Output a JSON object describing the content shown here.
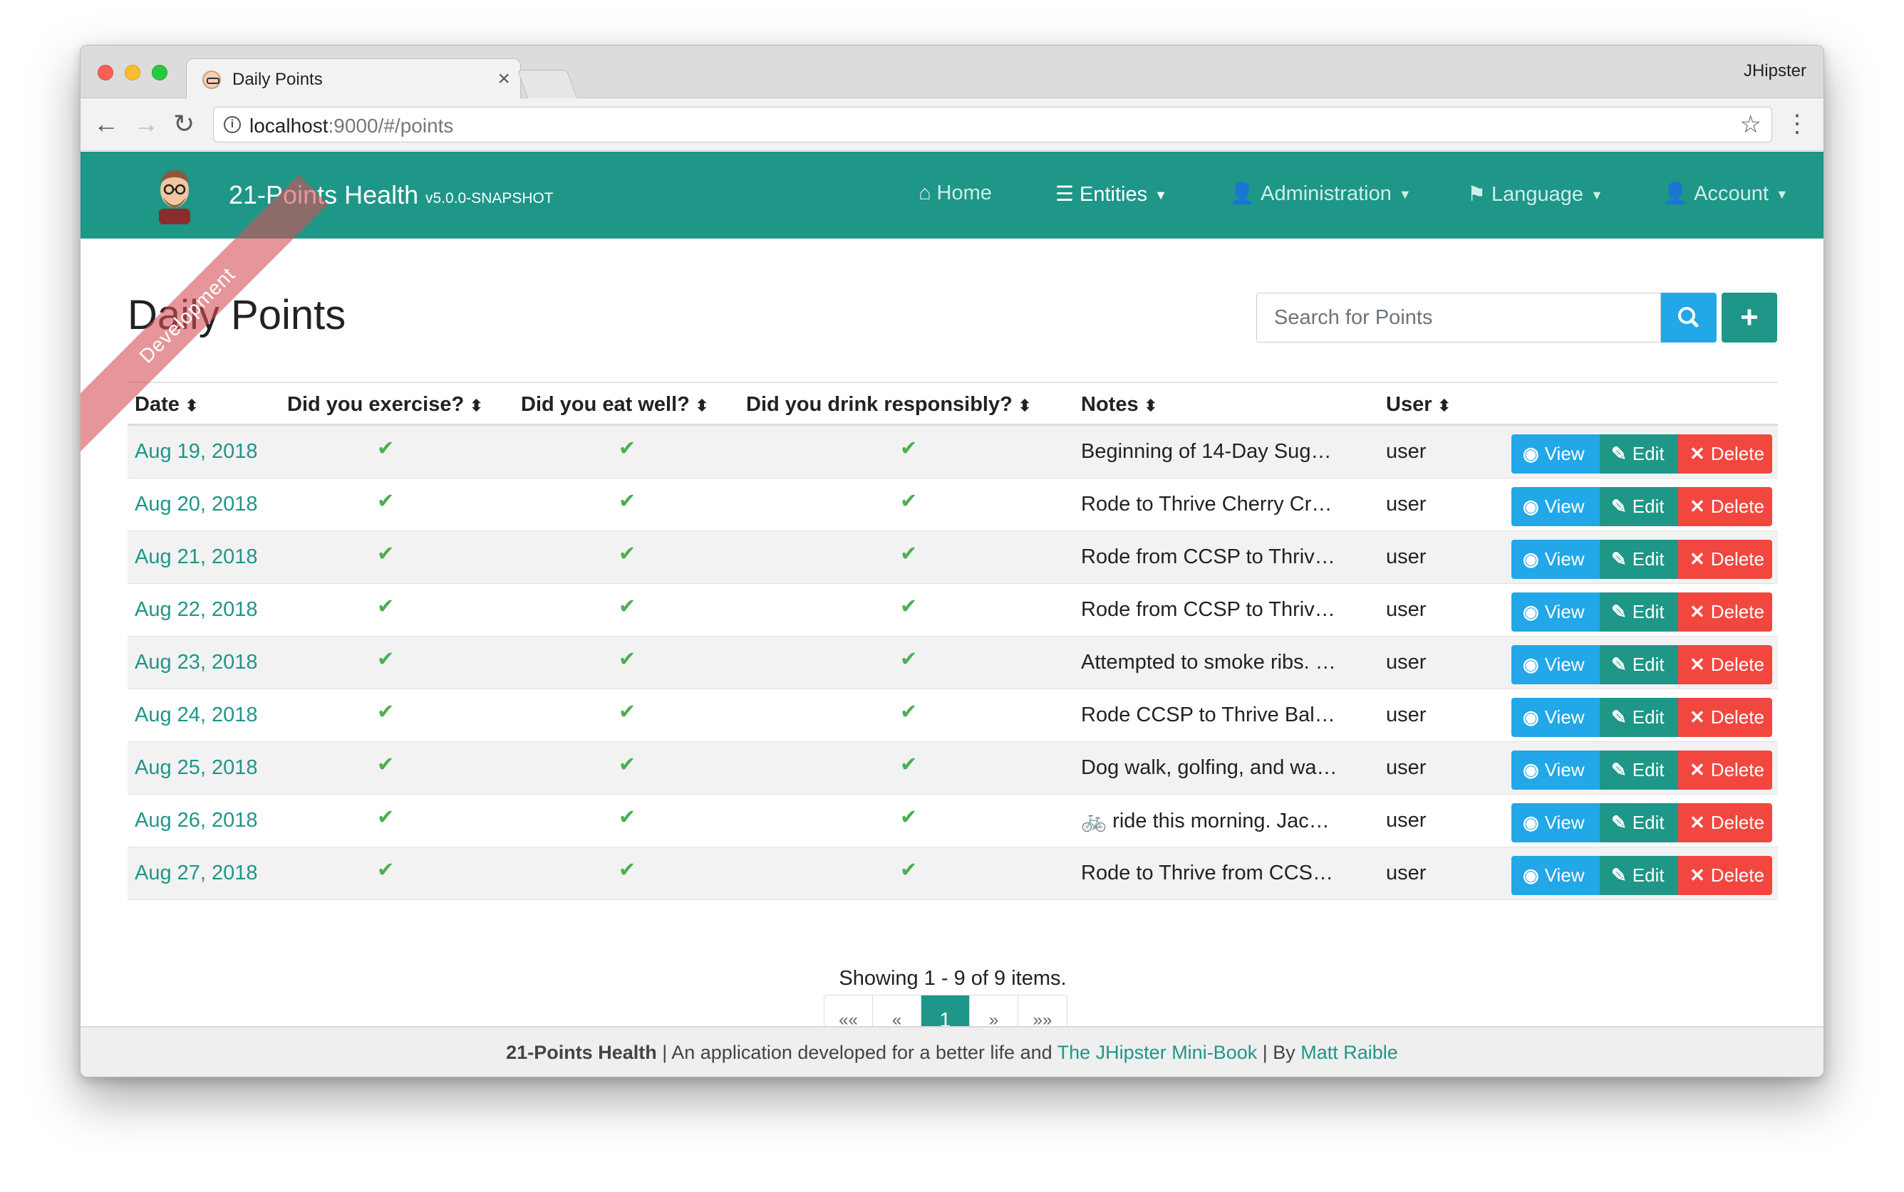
{
  "browser": {
    "tab_title": "Daily Points",
    "profile": "JHipster",
    "url_host": "localhost",
    "url_rest": ":9000/#/points"
  },
  "navbar": {
    "brand": "21-Points Health",
    "version": "v5.0.0-SNAPSHOT",
    "ribbon": "Development",
    "items": [
      {
        "label": "Home",
        "icon": "home-icon"
      },
      {
        "label": "Entities",
        "icon": "list-icon"
      },
      {
        "label": "Administration",
        "icon": "user-plus-icon"
      },
      {
        "label": "Language",
        "icon": "flag-icon"
      },
      {
        "label": "Account",
        "icon": "user-icon"
      }
    ]
  },
  "page": {
    "title": "Daily Points",
    "search_placeholder": "Search for Points"
  },
  "table": {
    "headers": [
      "Date",
      "Did you exercise?",
      "Did you eat well?",
      "Did you drink responsibly?",
      "Notes",
      "User"
    ],
    "rows": [
      {
        "date": "Aug 19, 2018",
        "notes": "Beginning of 14-Day Sug…",
        "user": "user"
      },
      {
        "date": "Aug 20, 2018",
        "notes": "Rode to Thrive Cherry Cr…",
        "user": "user"
      },
      {
        "date": "Aug 21, 2018",
        "notes": "Rode from CCSP to Thriv…",
        "user": "user"
      },
      {
        "date": "Aug 22, 2018",
        "notes": "Rode from CCSP to Thriv…",
        "user": "user"
      },
      {
        "date": "Aug 23, 2018",
        "notes": "Attempted to smoke ribs. …",
        "user": "user"
      },
      {
        "date": "Aug 24, 2018",
        "notes": "Rode CCSP to Thrive Bal…",
        "user": "user"
      },
      {
        "date": "Aug 25, 2018",
        "notes": "Dog walk, golfing, and wa…",
        "user": "user"
      },
      {
        "date": "Aug 26, 2018",
        "notes": "🚲 ride this morning. Jac…",
        "user": "user"
      },
      {
        "date": "Aug 27, 2018",
        "notes": "Rode to Thrive from CCS…",
        "user": "user"
      }
    ],
    "actions": {
      "view": "View",
      "edit": "Edit",
      "delete": "Delete"
    },
    "check_glyph": "✔"
  },
  "pagination": {
    "showing": "Showing 1 - 9 of 9 items.",
    "first": "««",
    "prev": "«",
    "current": "1",
    "next": "»",
    "last": "»»"
  },
  "footer": {
    "app": "21-Points Health",
    "text1": " | An application developed for a better life and ",
    "link1": "The JHipster Mini-Book",
    "text2": " | By ",
    "link2": "Matt Raible"
  },
  "colors": {
    "primary": "#1e9688",
    "info": "#22a7e8",
    "danger": "#f2473f",
    "success_check": "#4caf50"
  }
}
